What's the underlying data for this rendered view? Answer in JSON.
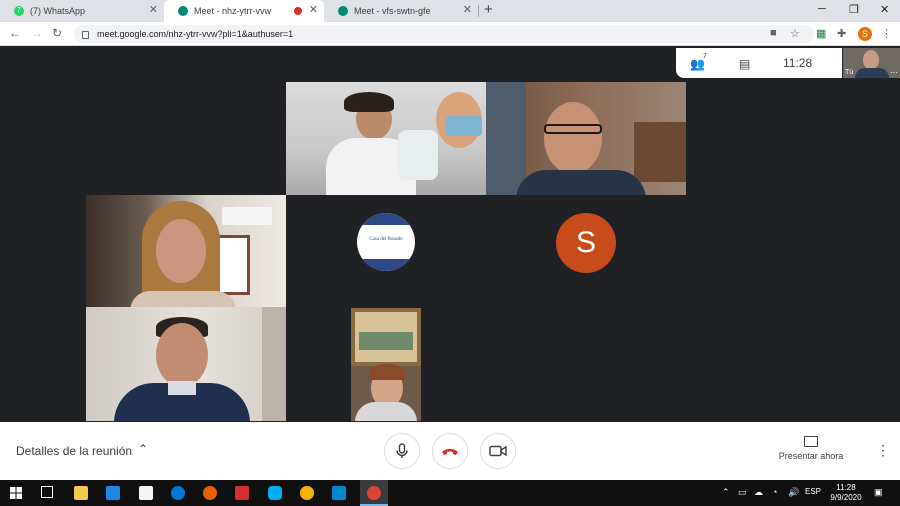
{
  "browser": {
    "tabs": [
      {
        "title": "(7) WhatsApp",
        "favicon_color": "#25d366",
        "favicon_text": "7"
      },
      {
        "title": "Meet - nhz-ytrr-vvw",
        "favicon_color": "#00897b",
        "active": true,
        "recording": true
      },
      {
        "title": "Meet - vfs-swtn-gfe",
        "favicon_color": "#00897b"
      }
    ],
    "new_tab_label": "+",
    "url": "meet.google.com/nhz-ytrr-vvw?pli=1&authuser=1",
    "profile_initial": "S"
  },
  "meet": {
    "participant_count": "7",
    "time": "11:28",
    "self_label": "Tú",
    "avatar_initial": "S",
    "avatar_color": "#c84b1b",
    "logo_text": "Casa del Rosado"
  },
  "controls": {
    "details_label": "Detalles de la reunión",
    "present_label": "Presentar ahora",
    "hangup_color": "#d93025"
  },
  "taskbar": {
    "language": "ESP",
    "time": "11:28",
    "date": "9/9/2020"
  }
}
